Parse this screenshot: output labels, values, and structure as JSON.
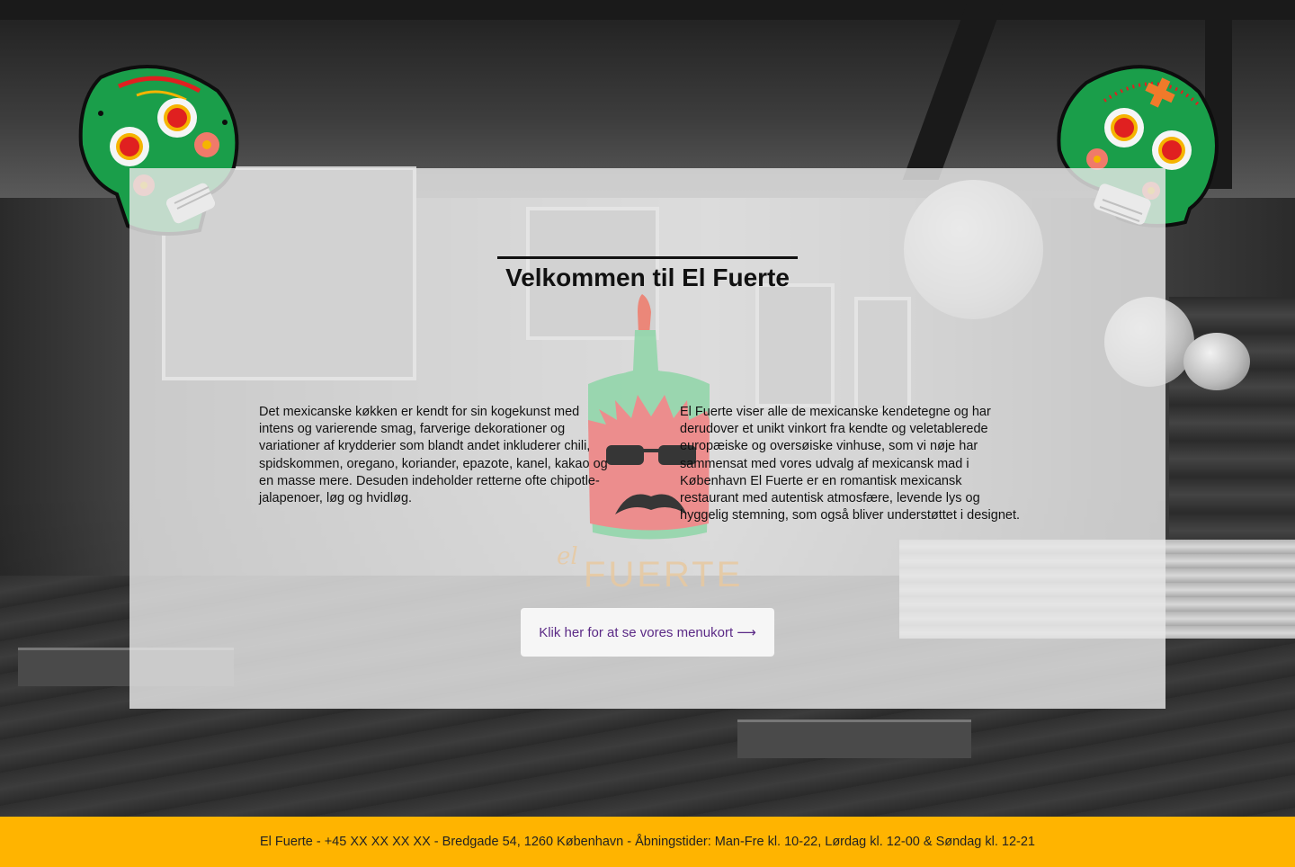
{
  "hero": {
    "title": "Velkommen til El Fuerte"
  },
  "intro": {
    "left_text": "Det mexicanske køkken er kendt for sin kogekunst med intens og varierende smag, farverige dekorationer og variationer af krydderier som blandt andet inkluderer chili, spidskommen, oregano, koriander, epazote, kanel, kakao og en masse mere. Desuden indeholder retterne ofte chipotle-jalapenoer, løg og hvidløg.",
    "right_text": "El Fuerte viser alle de mexicanske kendetegne og har derudover et unikt vinkort fra kendte og veletablerede europæiske og oversøiske vinhuse, som vi nøje har sammensat med vores udvalg af mexicansk mad i København El Fuerte er en romantisk mexicansk restaurant med autentisk atmosfære, levende lys og hyggelig stemning, som også bliver understøttet i designet."
  },
  "logo": {
    "prefix": "el",
    "name": "FUERTE",
    "icon": "chili-mascot-icon"
  },
  "cta": {
    "label": "Klik her for at se vores menukort ⟶"
  },
  "footer": {
    "text": "El Fuerte - +45 XX XX XX XX - Bredgade 54, 1260 København - Åbningstider: Man-Fre kl. 10-22, Lørdag kl. 12-00 & Søndag kl. 12-21"
  },
  "decor": {
    "left_icon": "sugar-skull-icon",
    "right_icon": "sugar-skull-icon"
  },
  "colors": {
    "footer_bg": "#ffb400",
    "link": "#5b2a86",
    "skull_green": "#1a9e4a",
    "skull_red": "#e02020",
    "logo_text": "#e8c9a0"
  }
}
